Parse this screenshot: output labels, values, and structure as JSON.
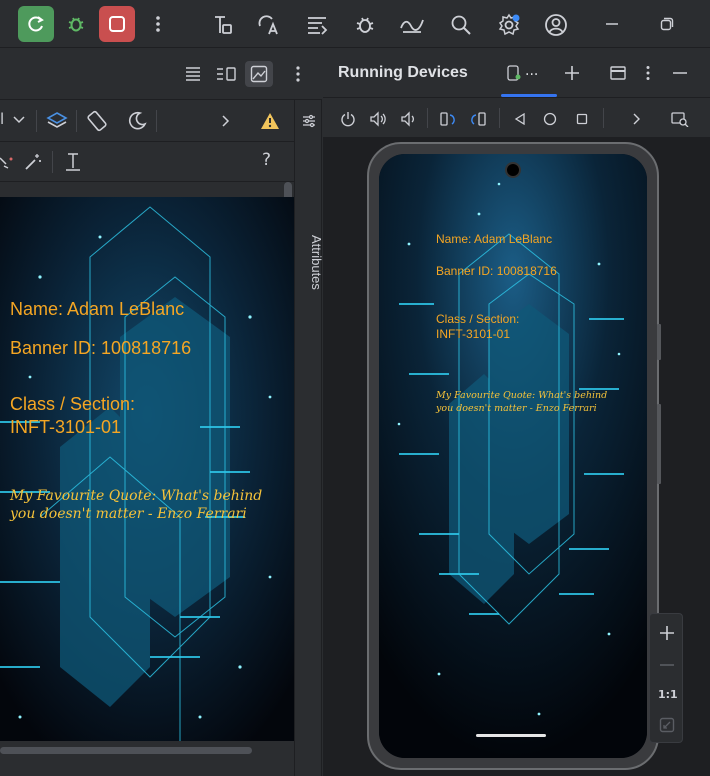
{
  "toolbar": {
    "icons": [
      "sync-icon",
      "debug-icon",
      "stop-icon",
      "more-icon",
      "layout-inspector-icon",
      "translate-icon",
      "logcat-icon",
      "bug-icon",
      "profiler-icon",
      "search-icon",
      "settings-icon",
      "account-icon",
      "minimize-icon",
      "restore-icon"
    ],
    "colors": {
      "green": "#4e9a5c",
      "red": "#c94f4f"
    }
  },
  "running_devices": {
    "title": "Running Devices",
    "tab_label": "...",
    "controls": [
      "power-icon",
      "volume-up-icon",
      "volume-down-icon",
      "rotate-left-icon",
      "rotate-right-icon",
      "back-icon",
      "home-icon",
      "overview-icon",
      "chevron-right-icon",
      "screen-record-icon"
    ]
  },
  "side": {
    "attributes_label": "Attributes"
  },
  "zoom": {
    "one_to_one": "1:1"
  },
  "preview": {
    "name": "Name: Adam LeBlanc",
    "banner": "Banner ID: 100818716",
    "class_label": "Class / Section:",
    "class_value": "INFT-3101-01",
    "quote_line1": "My Favourite Quote: What's behind",
    "quote_line2": "you doesn't matter - Enzo Ferrari"
  },
  "device": {
    "name": "Name: Adam LeBlanc",
    "banner": "Banner ID: 100818716",
    "class_label": "Class / Section:",
    "class_value": "INFT-3101-01",
    "quote_line1": "My Favourite Quote: What's behind",
    "quote_line2": "you doesn't matter - Enzo Ferrari"
  },
  "design_toolbar": {
    "dropdown_partial": "l",
    "help": "?"
  }
}
